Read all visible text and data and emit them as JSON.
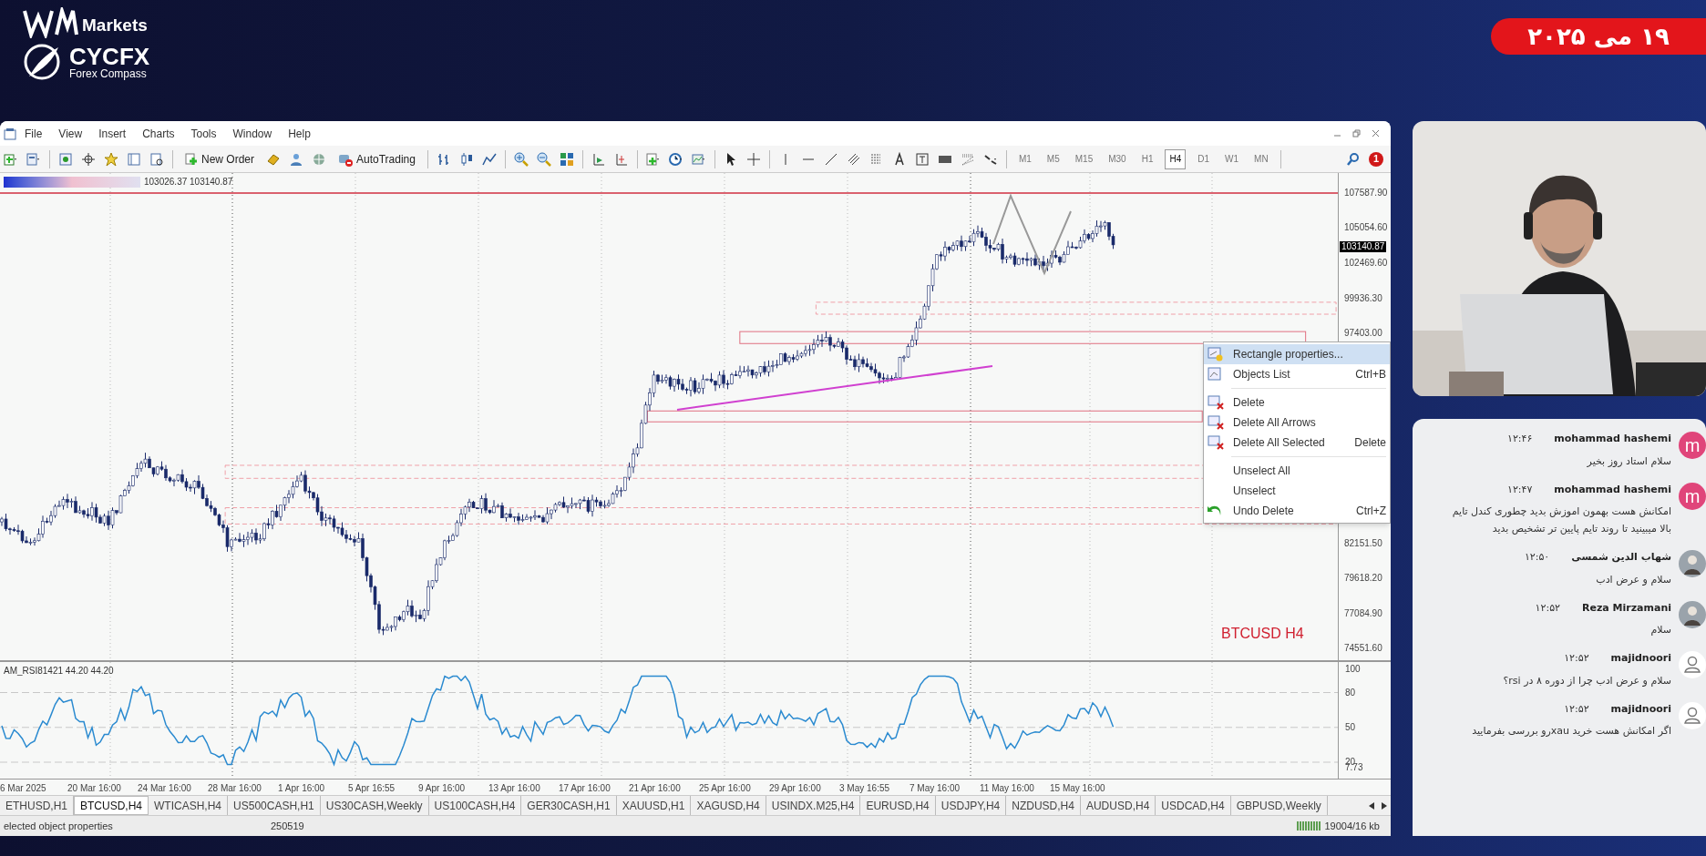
{
  "brand": {
    "top": "Markets",
    "name": "CYCFX",
    "tagline": "Forex Compass"
  },
  "date_badge": "۱۹ می ۲۰۲۵",
  "window": {
    "menu": [
      "File",
      "View",
      "Insert",
      "Charts",
      "Tools",
      "Window",
      "Help"
    ],
    "toolbar_buttons": [
      "New Order",
      "AutoTrading"
    ],
    "timeframes": [
      {
        "label": "M1",
        "selected": false
      },
      {
        "label": "M5",
        "selected": false
      },
      {
        "label": "M15",
        "selected": false
      },
      {
        "label": "M30",
        "selected": false
      },
      {
        "label": "H1",
        "selected": false
      },
      {
        "label": "H4",
        "selected": true
      },
      {
        "label": "D1",
        "selected": false
      },
      {
        "label": "W1",
        "selected": false
      },
      {
        "label": "MN",
        "selected": false
      }
    ],
    "notifications": "1"
  },
  "chart": {
    "header": "103026.37 103140.87",
    "watermark": "BTCUSD H4",
    "current_price": "103140.87",
    "price_labels": [
      "107587.90",
      "105054.60",
      "102469.60",
      "99936.30",
      "97403.00",
      "82151.50",
      "79618.20",
      "77084.90",
      "74551.60"
    ],
    "indicator": {
      "label": "AM_RSI81421 44.20 44.20",
      "levels": [
        "100",
        "80",
        "50",
        "20",
        "7.73"
      ]
    },
    "time_labels": [
      "6 Mar 2025",
      "20 Mar 16:00",
      "24 Mar 16:00",
      "28 Mar 16:00",
      "1 Apr 16:00",
      "5 Apr 16:55",
      "9 Apr 16:00",
      "13 Apr 16:00",
      "17 Apr 16:00",
      "21 Apr 16:00",
      "25 Apr 16:00",
      "29 Apr 16:00",
      "3 May 16:55",
      "7 May 16:00",
      "11 May 16:00",
      "15 May 16:00"
    ]
  },
  "context_menu": [
    {
      "label": "Rectangle properties...",
      "selected": true,
      "kind": "properties"
    },
    {
      "label": "Objects List",
      "shortcut": "Ctrl+B",
      "selected": false,
      "kind": "list"
    },
    {
      "label": "Delete",
      "selected": false,
      "kind": "delete",
      "separator_before": true
    },
    {
      "label": "Delete All Arrows",
      "selected": false,
      "kind": "delete"
    },
    {
      "label": "Delete All Selected",
      "shortcut": "Delete",
      "selected": false,
      "kind": "delete"
    },
    {
      "label": "Unselect All",
      "selected": false,
      "kind": "plain",
      "separator_before": true
    },
    {
      "label": "Unselect",
      "selected": false,
      "kind": "plain"
    },
    {
      "label": "Undo Delete",
      "shortcut": "Ctrl+Z",
      "selected": false,
      "kind": "undo"
    }
  ],
  "tabs": [
    {
      "label": "ETHUSD,H1",
      "selected": false
    },
    {
      "label": "BTCUSD,H4",
      "selected": true
    },
    {
      "label": "WTICASH,H4",
      "selected": false
    },
    {
      "label": "US500CASH,H1",
      "selected": false
    },
    {
      "label": "US30CASH,Weekly",
      "selected": false
    },
    {
      "label": "US100CASH,H4",
      "selected": false
    },
    {
      "label": "GER30CASH,H1",
      "selected": false
    },
    {
      "label": "XAUUSD,H1",
      "selected": false
    },
    {
      "label": "XAGUSD,H4",
      "selected": false
    },
    {
      "label": "USINDX.M25,H4",
      "selected": false
    },
    {
      "label": "EURUSD,H4",
      "selected": false
    },
    {
      "label": "USDJPY,H4",
      "selected": false
    },
    {
      "label": "NZDUSD,H4",
      "selected": false
    },
    {
      "label": "AUDUSD,H4",
      "selected": false
    },
    {
      "label": "USDCAD,H4",
      "selected": false
    },
    {
      "label": "GBPUSD,Weekly",
      "selected": false
    }
  ],
  "status_bar": {
    "message": "elected object properties",
    "profile": "250519",
    "traffic": "19004/16 kb"
  },
  "chat": [
    {
      "name": "mohammad hashemi",
      "time": "۱۲:۴۶",
      "text": "سلام استاد روز بخیر",
      "kind": "letter",
      "letter": "m"
    },
    {
      "name": "mohammad hashemi",
      "time": "۱۲:۴۷",
      "text": "امکانش هست بهمون اموزش بدید چطوری کندل تایم بالا میبینید تا روند تایم پایین تر تشخیص بدید",
      "kind": "letter",
      "letter": "m"
    },
    {
      "name": "شهاب الدین شمسی",
      "time": "۱۲:۵۰",
      "text": "سلام و عرض ادب"
    },
    {
      "name": "Reza Mirzamani",
      "time": "۱۲:۵۲",
      "text": "سلام"
    },
    {
      "name": "majidnoori",
      "time": "۱۲:۵۲",
      "text": "سلام و عرض ادب چرا از دوره ۸ در rsi؟",
      "kind": "default"
    },
    {
      "name": "majidnoori",
      "time": "۱۲:۵۲",
      "text": "اگر امکانش هست خرید xauرو بررسی بفرمایید",
      "kind": "default"
    }
  ]
}
